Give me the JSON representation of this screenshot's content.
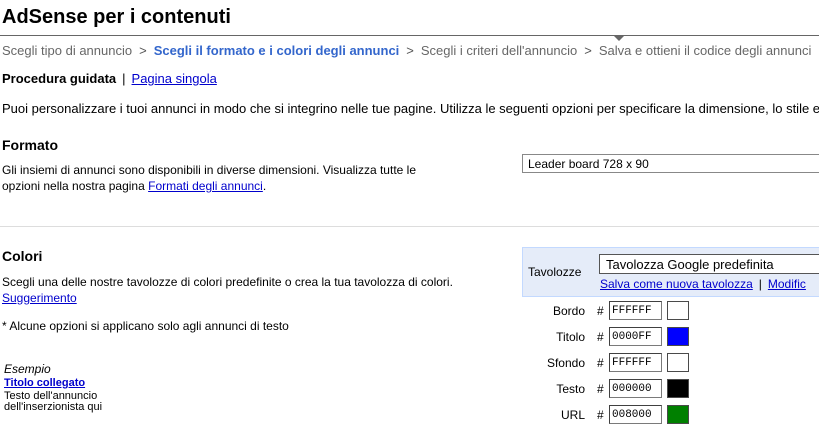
{
  "page": {
    "title": "AdSense per i contenuti"
  },
  "breadcrumb": {
    "steps": [
      "Scegli tipo di annuncio",
      "Scegli il formato e i colori degli annunci",
      "Scegli i criteri dell'annuncio",
      "Salva e ottieni il codice degli annunci"
    ],
    "separator": ">"
  },
  "mode": {
    "current": "Procedura guidata",
    "separator": "|",
    "other_link": "Pagina singola"
  },
  "intro": "Puoi personalizzare i tuoi annunci in modo che si integrino nelle tue pagine. Utilizza le seguenti opzioni per specificare la dimensione, lo stile e",
  "format": {
    "heading": "Formato",
    "desc_line1": "Gli insiemi di annunci sono disponibili in diverse dimensioni. Visualizza tutte le",
    "desc_line2_prefix": "opzioni nella nostra pagina ",
    "desc_link": "Formati degli annunci",
    "desc_suffix": ".",
    "selected": "Leader board 728 x 90"
  },
  "colors": {
    "heading": "Colori",
    "desc": "Scegli una delle nostre tavolozze di colori predefinite o crea la tua tavolozza di colori.",
    "tip_link": "Suggerimento",
    "note": "* Alcune opzioni si applicano solo agli annunci di testo",
    "palette_label": "Tavolozze",
    "palette_selected": "Tavolozza Google predefinita",
    "save_link": "Salva come nuova tavolozza",
    "links_separator": "|",
    "edit_link": "Modific",
    "hash": "#",
    "rows": [
      {
        "label": "Bordo",
        "hex": "FFFFFF",
        "color": "#FFFFFF"
      },
      {
        "label": "Titolo",
        "hex": "0000FF",
        "color": "#0000FF"
      },
      {
        "label": "Sfondo",
        "hex": "FFFFFF",
        "color": "#FFFFFF"
      },
      {
        "label": "Testo",
        "hex": "000000",
        "color": "#000000"
      },
      {
        "label": "URL",
        "hex": "008000",
        "color": "#008000"
      }
    ]
  },
  "example": {
    "caption": "Esempio",
    "ad_title": "Titolo collegato",
    "ad_line1": "Testo dell'annuncio",
    "ad_line2": "dell'inserzionista qui"
  },
  "theme": {
    "link": "#0000CC",
    "active_step": "#3366CC",
    "palette_bg": "#E5ECF9"
  }
}
